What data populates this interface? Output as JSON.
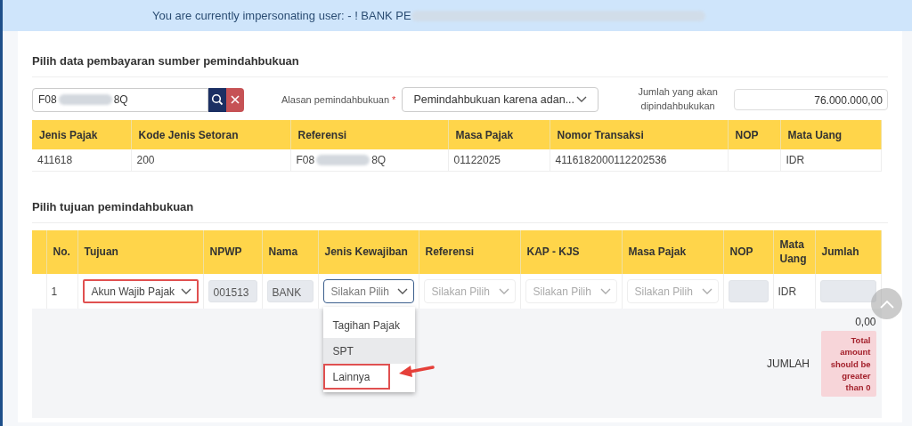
{
  "banner": {
    "text": "You are currently impersonating user: - ! BANK PE",
    "redacted": true
  },
  "source": {
    "title": "Pilih data pembayaran sumber pemindahbukuan",
    "search": {
      "value_start": "F08",
      "value_end": "8Q",
      "redacted": true
    },
    "reason": {
      "label": "Alasan pemindahbukuan",
      "required_mark": "*",
      "value": "Pemindahbukuan karena adan..."
    },
    "amount": {
      "label": "Jumlah yang akan dipindahbukukan",
      "value": "76.000.000,00"
    },
    "table": {
      "columns": [
        "Jenis Pajak",
        "Kode Jenis Setoran",
        "Referensi",
        "Masa Pajak",
        "Nomor Transaksi",
        "NOP",
        "Mata Uang"
      ],
      "rows": [
        {
          "cells": [
            {
              "text": "411618"
            },
            {
              "text": "200"
            },
            {
              "text": "F08",
              "text_end": "8Q",
              "redacted": true
            },
            {
              "text": "01122025"
            },
            {
              "text": "4116182000112202536"
            },
            {
              "text": ""
            },
            {
              "text": "IDR"
            }
          ]
        }
      ]
    }
  },
  "target": {
    "title": "Pilih tujuan pemindahbukuan",
    "table": {
      "columns": [
        "",
        "No.",
        "Tujuan",
        "NPWP",
        "Nama",
        "Jenis Kewajiban",
        "Referensi",
        "KAP - KJS",
        "Masa Pajak",
        "NOP",
        "Mata Uang",
        "Jumlah"
      ],
      "rows": [
        {
          "cells": [
            {
              "kind": "blank"
            },
            {
              "kind": "text",
              "value": "1"
            },
            {
              "kind": "select",
              "value": "Akun Wajib Pajak",
              "annotated": true,
              "focused": false,
              "disabled": false
            },
            {
              "kind": "input",
              "value": "001513",
              "disabled": true
            },
            {
              "kind": "input",
              "value": "BANK",
              "disabled": true
            },
            {
              "kind": "select",
              "placeholder": "Silakan Pilih",
              "annotated": false,
              "focused": true,
              "disabled": false,
              "expanded": true,
              "options": [
                {
                  "label": "Tagihan Pajak",
                  "highlighted": false,
                  "annotated": false
                },
                {
                  "label": "SPT",
                  "highlighted": true,
                  "annotated": false
                },
                {
                  "label": "Lainnya",
                  "highlighted": false,
                  "annotated": true
                }
              ]
            },
            {
              "kind": "select",
              "placeholder": "Silakan Pilih",
              "annotated": false,
              "focused": false,
              "disabled": true
            },
            {
              "kind": "select",
              "placeholder": "Silakan Pilih",
              "annotated": false,
              "focused": false,
              "disabled": true
            },
            {
              "kind": "select",
              "placeholder": "Silakan Pilih",
              "annotated": false,
              "focused": false,
              "disabled": true
            },
            {
              "kind": "input",
              "disabled": true
            },
            {
              "kind": "text",
              "value": "IDR"
            },
            {
              "kind": "input",
              "disabled": true
            }
          ]
        }
      ],
      "total": {
        "label": "JUMLAH",
        "value": "0,00",
        "error": "Total amount should be greater than 0"
      }
    }
  }
}
